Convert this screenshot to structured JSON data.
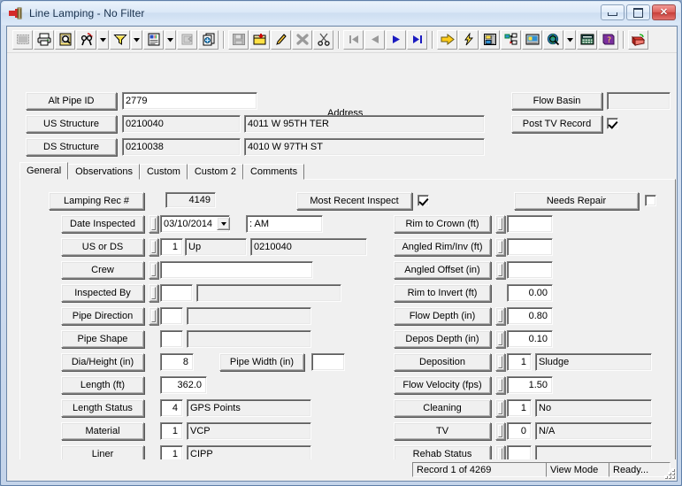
{
  "window": {
    "title": "Line Lamping - No Filter",
    "icon": "line-lamping-app-icon",
    "minimize_label": "Minimize",
    "maximize_label": "Maximize",
    "close_label": "Close"
  },
  "toolbar": {
    "buttons": [
      {
        "name": "select-all-icon",
        "label": "Select All",
        "disabled": true
      },
      {
        "name": "print-icon",
        "label": "Print",
        "disabled": false
      },
      {
        "name": "print-preview-icon",
        "label": "Print Preview",
        "disabled": false
      },
      {
        "name": "find-icon",
        "label": "Find",
        "disabled": false
      },
      {
        "name": "find-dropdown-icon",
        "label": "Find Options",
        "disabled": false
      },
      {
        "name": "filter-icon",
        "label": "Filter",
        "disabled": false
      },
      {
        "name": "filter-dropdown-icon",
        "label": "Filter Options",
        "disabled": false
      },
      {
        "name": "report-icon",
        "label": "Report",
        "disabled": false
      },
      {
        "name": "report-dropdown-icon",
        "label": "Report Options",
        "disabled": false
      },
      {
        "name": "export-icon",
        "label": "Export",
        "disabled": true
      },
      {
        "name": "copy-record-icon",
        "label": "Copy Record",
        "disabled": false
      },
      {
        "name": "save-icon",
        "label": "Save",
        "disabled": true
      },
      {
        "name": "add-record-icon",
        "label": "Add Record",
        "disabled": false
      },
      {
        "name": "edit-record-icon",
        "label": "Edit Record",
        "disabled": false
      },
      {
        "name": "delete-record-icon",
        "label": "Delete Record",
        "disabled": true
      },
      {
        "name": "cut-icon",
        "label": "Cut",
        "disabled": false
      },
      {
        "name": "first-record-icon",
        "label": "First Record",
        "disabled": true
      },
      {
        "name": "previous-record-icon",
        "label": "Previous Record",
        "disabled": true
      },
      {
        "name": "next-record-icon",
        "label": "Next Record",
        "disabled": false
      },
      {
        "name": "last-record-icon",
        "label": "Last Record",
        "disabled": false
      },
      {
        "name": "goto-icon",
        "label": "Go To",
        "disabled": false
      },
      {
        "name": "quick-action-icon",
        "label": "Quick Action",
        "disabled": false
      },
      {
        "name": "layout-icon",
        "label": "Layout",
        "disabled": false
      },
      {
        "name": "hierarchy-icon",
        "label": "Hierarchy",
        "disabled": false
      },
      {
        "name": "media-icon",
        "label": "Media",
        "disabled": false
      },
      {
        "name": "map-icon",
        "label": "Map",
        "disabled": false
      },
      {
        "name": "map-dropdown-icon",
        "label": "Map Options",
        "disabled": false
      },
      {
        "name": "calculator-icon",
        "label": "Calculator",
        "disabled": false
      },
      {
        "name": "help-icon",
        "label": "Help",
        "disabled": false
      },
      {
        "name": "exit-icon",
        "label": "Exit",
        "disabled": false
      }
    ]
  },
  "header": {
    "alt_pipe_id_label": "Alt Pipe ID",
    "alt_pipe_id_value": "2779",
    "address_label": "Address",
    "us_structure_label": "US Structure",
    "us_structure_value": "0210040",
    "us_structure_address": "4011 W 95TH TER",
    "ds_structure_label": "DS Structure",
    "ds_structure_value": "0210038",
    "ds_structure_address": "4010 W 97TH ST",
    "flow_basin_label": "Flow Basin",
    "flow_basin_value": "",
    "post_tv_record_label": "Post TV Record",
    "post_tv_record_checked": true
  },
  "tabs": [
    {
      "label": "General",
      "active": true
    },
    {
      "label": "Observations",
      "active": false
    },
    {
      "label": "Custom",
      "active": false
    },
    {
      "label": "Custom 2",
      "active": false
    },
    {
      "label": "Comments",
      "active": false
    }
  ],
  "general": {
    "lamping_rec_label": "Lamping Rec #",
    "lamping_rec_value": "4149",
    "most_recent_inspect_label": "Most Recent Inspect",
    "most_recent_inspect_checked": true,
    "needs_repair_label": "Needs Repair",
    "needs_repair_checked": false,
    "left_rows": [
      {
        "label": "Date Inspected",
        "spin": true,
        "combo": true,
        "value": "03/10/2014",
        "value2": ": AM",
        "kind": "date"
      },
      {
        "label": "US or DS",
        "spin": true,
        "code": "1",
        "desc": "Up",
        "extra": "0210040",
        "kind": "code-desc-extra"
      },
      {
        "label": "Crew",
        "spin": true,
        "value": "",
        "kind": "wide"
      },
      {
        "label": "Inspected By",
        "spin": true,
        "code": "",
        "desc": "",
        "kind": "code-desc"
      },
      {
        "label": "Pipe Direction",
        "spin": true,
        "code": "",
        "desc": "",
        "kind": "code-desc"
      },
      {
        "label": "Pipe Shape",
        "spin": false,
        "code": "",
        "desc": "",
        "kind": "code-desc"
      },
      {
        "label": "Dia/Height (in)",
        "spin": false,
        "value": "8",
        "kind": "num-pair",
        "pair_label": "Pipe Width (in)",
        "pair_value": ""
      },
      {
        "label": "Length (ft)",
        "spin": false,
        "value": "362.0",
        "kind": "num"
      },
      {
        "label": "Length Status",
        "spin": false,
        "code": "4",
        "desc": "GPS Points",
        "kind": "code-desc"
      },
      {
        "label": "Material",
        "spin": false,
        "code": "1",
        "desc": "VCP",
        "kind": "code-desc"
      },
      {
        "label": "Liner",
        "spin": false,
        "code": "1",
        "desc": "CIPP",
        "kind": "code-desc"
      }
    ],
    "right_rows": [
      {
        "label": "Rim to Crown (ft)",
        "spin": true,
        "value": "",
        "kind": "num"
      },
      {
        "label": "Angled Rim/Inv (ft)",
        "spin": true,
        "value": "",
        "kind": "num"
      },
      {
        "label": "Angled Offset (in)",
        "spin": true,
        "value": "",
        "kind": "num"
      },
      {
        "label": "Rim to Invert (ft)",
        "spin": false,
        "value": "0.00",
        "kind": "num"
      },
      {
        "label": "Flow Depth (in)",
        "spin": true,
        "value": "0.80",
        "kind": "num"
      },
      {
        "label": "Depos Depth (in)",
        "spin": true,
        "value": "0.10",
        "kind": "num"
      },
      {
        "label": "Deposition",
        "spin": true,
        "code": "1",
        "desc": "Sludge",
        "kind": "code-desc"
      },
      {
        "label": "Flow Velocity (fps)",
        "spin": true,
        "value": "1.50",
        "kind": "num"
      },
      {
        "label": "Cleaning",
        "spin": true,
        "code": "1",
        "desc": "No",
        "kind": "code-desc"
      },
      {
        "label": "TV",
        "spin": true,
        "code": "0",
        "desc": "N/A",
        "kind": "code-desc"
      },
      {
        "label": "Rehab Status",
        "spin": true,
        "code": "",
        "desc": "",
        "kind": "code-desc"
      }
    ]
  },
  "statusbar": {
    "record": "Record 1 of 4269",
    "mode": "View Mode",
    "state": "Ready..."
  },
  "colors": {
    "face": "#f0f0f0",
    "frame": "#6d87a8",
    "titlebar_text": "#19314d",
    "accent_yellow": "#ffd700",
    "accent_red": "#c0392b"
  }
}
